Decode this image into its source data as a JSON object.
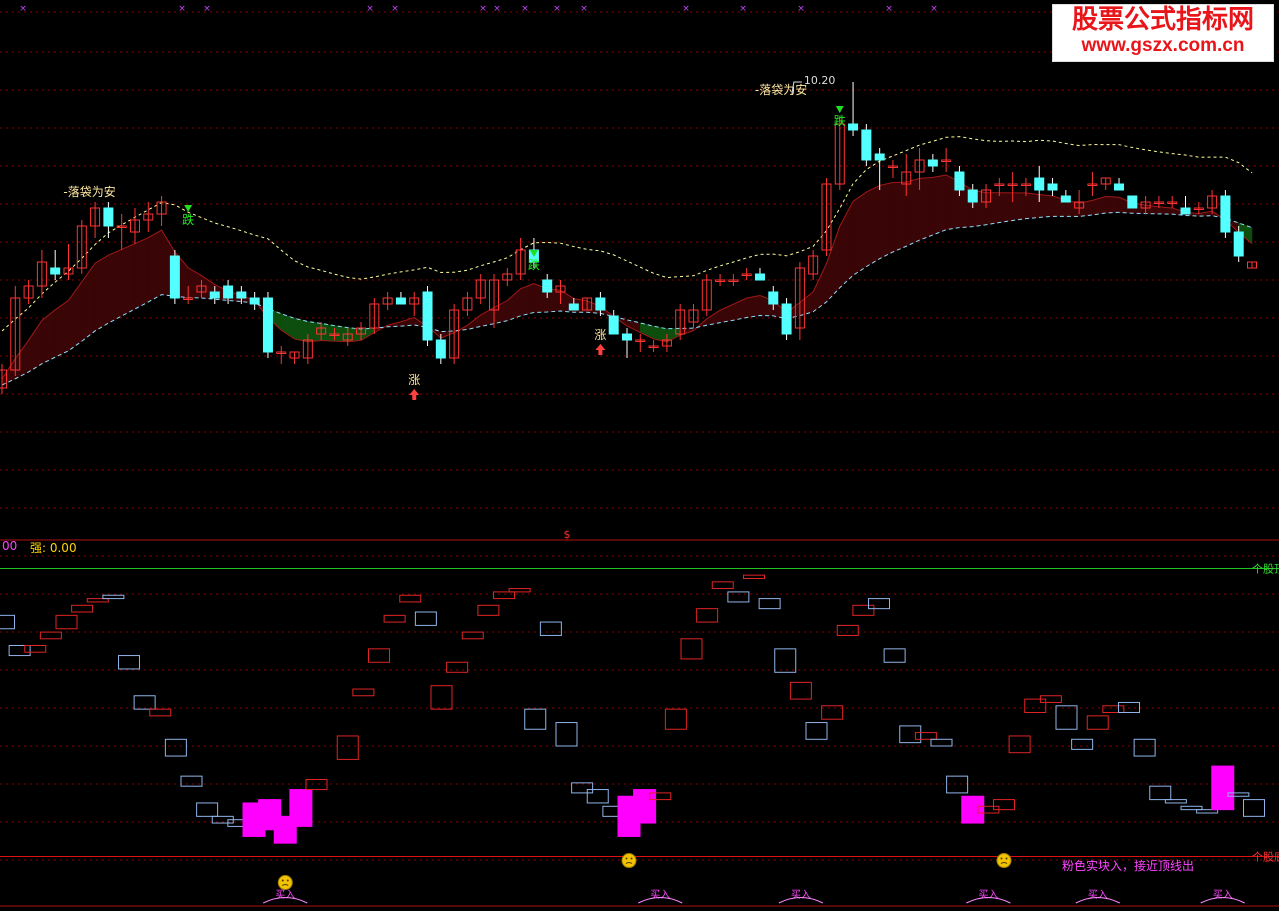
{
  "watermark": {
    "title": "股票公式指标网",
    "url": "www.gszx.com.cn"
  },
  "subpanel_header": {
    "left_value": "00",
    "strength_label": "强: 0.00",
    "dollar_mark": "$"
  },
  "labels": {
    "safe": "-落袋为安",
    "fall": "跌",
    "rise": "涨",
    "price_peak": "10.20",
    "top_line": "个股顶",
    "bottom_line": "个股底",
    "note": "粉色实块入，接近顶线出",
    "buy": "买入"
  },
  "colors": {
    "up": "#ff3333",
    "down": "#54ffff",
    "cloud_red": "#3a0506",
    "cloud_red_edge": "#a01818",
    "cloud_green": "#0d4d0d",
    "dashed_line": "#ffff99",
    "osc_red": "#e02424",
    "osc_blue": "#8fb4e8",
    "osc_pink": "#ff00ff",
    "grid": "#8b0000",
    "top_line": "#22c422",
    "bottom_line": "#dd1111"
  },
  "chart_data": [
    {
      "type": "candlestick",
      "candles": [
        [
          7.5,
          7.9,
          7.4,
          7.8
        ],
        [
          7.8,
          9.2,
          7.7,
          9.0
        ],
        [
          9.0,
          9.3,
          8.9,
          9.2
        ],
        [
          9.2,
          9.8,
          9.0,
          9.6
        ],
        [
          9.5,
          9.8,
          9.3,
          9.4
        ],
        [
          9.4,
          9.9,
          9.3,
          9.5
        ],
        [
          9.5,
          10.3,
          9.4,
          10.2
        ],
        [
          10.2,
          10.6,
          10.0,
          10.5
        ],
        [
          10.5,
          10.6,
          10.0,
          10.2
        ],
        [
          10.2,
          10.4,
          9.8,
          10.2
        ],
        [
          10.1,
          10.5,
          9.9,
          10.3
        ],
        [
          10.3,
          10.6,
          10.1,
          10.4
        ],
        [
          10.4,
          10.7,
          10.2,
          10.6
        ],
        [
          9.7,
          9.8,
          8.9,
          9.0
        ],
        [
          9.0,
          9.2,
          8.9,
          9.0
        ],
        [
          9.1,
          9.3,
          9.0,
          9.2
        ],
        [
          9.1,
          9.2,
          8.9,
          9.0
        ],
        [
          9.2,
          9.3,
          8.9,
          9.0
        ],
        [
          9.1,
          9.2,
          8.9,
          9.0
        ],
        [
          9.0,
          9.1,
          8.8,
          8.9
        ],
        [
          9.0,
          9.1,
          8.0,
          8.1
        ],
        [
          8.1,
          8.2,
          7.9,
          8.1
        ],
        [
          8.0,
          8.1,
          7.9,
          8.1
        ],
        [
          8.0,
          8.4,
          7.9,
          8.3
        ],
        [
          8.4,
          8.6,
          8.3,
          8.5
        ],
        [
          8.4,
          8.5,
          8.3,
          8.4
        ],
        [
          8.3,
          8.5,
          8.2,
          8.4
        ],
        [
          8.4,
          8.6,
          8.3,
          8.5
        ],
        [
          8.5,
          9.0,
          8.4,
          8.9
        ],
        [
          8.9,
          9.1,
          8.8,
          9.0
        ],
        [
          9.0,
          9.1,
          8.9,
          8.9
        ],
        [
          8.9,
          9.1,
          8.7,
          9.0
        ],
        [
          9.1,
          9.2,
          8.2,
          8.3
        ],
        [
          8.3,
          8.4,
          7.9,
          8.0
        ],
        [
          8.0,
          8.9,
          7.9,
          8.8
        ],
        [
          8.8,
          9.1,
          8.7,
          9.0
        ],
        [
          9.0,
          9.4,
          8.9,
          9.3
        ],
        [
          8.8,
          9.4,
          8.5,
          9.3
        ],
        [
          9.3,
          9.5,
          9.2,
          9.4
        ],
        [
          9.4,
          10.0,
          9.3,
          9.8
        ],
        [
          9.8,
          10.0,
          9.5,
          9.6
        ],
        [
          9.3,
          9.4,
          9.0,
          9.1
        ],
        [
          9.1,
          9.3,
          8.9,
          9.2
        ],
        [
          8.9,
          9.0,
          8.8,
          8.8
        ],
        [
          8.8,
          9.0,
          8.8,
          9.0
        ],
        [
          9.0,
          9.1,
          8.7,
          8.8
        ],
        [
          8.7,
          8.8,
          8.4,
          8.4
        ],
        [
          8.4,
          8.5,
          8.0,
          8.3
        ],
        [
          8.3,
          8.4,
          8.1,
          8.3
        ],
        [
          8.2,
          8.3,
          8.1,
          8.2
        ],
        [
          8.2,
          8.4,
          8.1,
          8.3
        ],
        [
          8.4,
          8.9,
          8.3,
          8.8
        ],
        [
          8.6,
          8.9,
          8.5,
          8.8
        ],
        [
          8.8,
          9.4,
          8.7,
          9.3
        ],
        [
          9.3,
          9.4,
          9.2,
          9.3
        ],
        [
          9.3,
          9.4,
          9.2,
          9.3
        ],
        [
          9.4,
          9.5,
          9.3,
          9.4
        ],
        [
          9.4,
          9.5,
          9.3,
          9.3
        ],
        [
          9.1,
          9.2,
          8.8,
          8.9
        ],
        [
          8.9,
          9.0,
          8.3,
          8.4
        ],
        [
          8.5,
          9.6,
          8.3,
          9.5
        ],
        [
          9.4,
          9.8,
          9.3,
          9.7
        ],
        [
          9.8,
          11.0,
          9.7,
          10.9
        ],
        [
          10.9,
          12.0,
          10.8,
          11.9
        ],
        [
          11.9,
          12.6,
          11.7,
          11.8
        ],
        [
          11.8,
          11.9,
          11.2,
          11.3
        ],
        [
          11.4,
          11.5,
          10.8,
          11.3
        ],
        [
          11.2,
          11.3,
          11.0,
          11.2
        ],
        [
          10.9,
          11.4,
          10.7,
          11.1
        ],
        [
          11.1,
          11.5,
          10.8,
          11.3
        ],
        [
          11.3,
          11.4,
          11.1,
          11.2
        ],
        [
          11.3,
          11.5,
          11.1,
          11.3
        ],
        [
          11.1,
          11.2,
          10.7,
          10.8
        ],
        [
          10.8,
          10.9,
          10.5,
          10.6
        ],
        [
          10.6,
          10.9,
          10.5,
          10.8
        ],
        [
          10.9,
          11.0,
          10.7,
          10.9
        ],
        [
          10.9,
          11.1,
          10.6,
          10.9
        ],
        [
          10.9,
          11.0,
          10.7,
          10.9
        ],
        [
          11.0,
          11.2,
          10.6,
          10.8
        ],
        [
          10.9,
          11.0,
          10.7,
          10.8
        ],
        [
          10.7,
          10.8,
          10.6,
          10.6
        ],
        [
          10.5,
          10.8,
          10.4,
          10.6
        ],
        [
          10.9,
          11.1,
          10.7,
          10.9
        ],
        [
          10.9,
          11.0,
          10.8,
          11.0
        ],
        [
          10.9,
          11.0,
          10.8,
          10.8
        ],
        [
          10.7,
          10.7,
          10.5,
          10.5
        ],
        [
          10.5,
          10.7,
          10.4,
          10.6
        ],
        [
          10.6,
          10.7,
          10.5,
          10.6
        ],
        [
          10.6,
          10.7,
          10.5,
          10.6
        ],
        [
          10.5,
          10.7,
          10.4,
          10.4
        ],
        [
          10.5,
          10.6,
          10.4,
          10.5
        ],
        [
          10.5,
          10.8,
          10.4,
          10.7
        ],
        [
          10.7,
          10.8,
          10.0,
          10.1
        ],
        [
          10.1,
          10.2,
          9.6,
          9.7
        ],
        [
          9.5,
          9.6,
          9.5,
          9.6
        ]
      ],
      "markers": [
        {
          "kind": "safe",
          "index": 8,
          "price": 10.7
        },
        {
          "kind": "fall",
          "index": 14,
          "price": 10.35
        },
        {
          "kind": "rise",
          "index": 31,
          "price": 7.5
        },
        {
          "kind": "fall",
          "index": 40,
          "price": 9.6
        },
        {
          "kind": "rise",
          "index": 45,
          "price": 8.25
        },
        {
          "kind": "safe",
          "index": 60,
          "price": 12.4
        },
        {
          "kind": "peak",
          "index": 60,
          "price": 12.6
        },
        {
          "kind": "fall",
          "index": 63,
          "price": 12.0
        }
      ]
    },
    {
      "type": "oscillator",
      "top_level": 93,
      "bottom_level": 7,
      "boxes": [
        [
          0.0,
          75,
          79,
          "b"
        ],
        [
          1.0,
          67,
          70,
          "b"
        ],
        [
          2.0,
          68,
          70,
          "r"
        ],
        [
          3.0,
          72,
          74,
          "r"
        ],
        [
          4.0,
          75,
          79,
          "r"
        ],
        [
          5.0,
          80,
          82,
          "r"
        ],
        [
          6.0,
          83,
          84,
          "r"
        ],
        [
          7.0,
          84,
          85,
          "b"
        ],
        [
          8.0,
          63,
          67,
          "b"
        ],
        [
          9.0,
          51,
          55,
          "b"
        ],
        [
          10.0,
          49,
          51,
          "r"
        ],
        [
          11.0,
          37,
          42,
          "b"
        ],
        [
          12.0,
          28,
          31,
          "b"
        ],
        [
          13.0,
          19,
          23,
          "b"
        ],
        [
          14.0,
          17,
          19,
          "b"
        ],
        [
          15.0,
          16,
          18,
          "b"
        ],
        [
          16.0,
          13,
          23,
          "p"
        ],
        [
          17.0,
          15,
          24,
          "p"
        ],
        [
          18.0,
          11,
          19,
          "p"
        ],
        [
          19.0,
          16,
          27,
          "p"
        ],
        [
          20.0,
          27,
          30,
          "r"
        ],
        [
          22.0,
          36,
          43,
          "r"
        ],
        [
          23.0,
          55,
          57,
          "r"
        ],
        [
          24.0,
          65,
          69,
          "r"
        ],
        [
          25.0,
          77,
          79,
          "r"
        ],
        [
          26.0,
          83,
          85,
          "r"
        ],
        [
          27.0,
          76,
          80,
          "b"
        ],
        [
          28.0,
          51,
          58,
          "r"
        ],
        [
          29.0,
          62,
          65,
          "r"
        ],
        [
          30.0,
          72,
          74,
          "r"
        ],
        [
          31.0,
          79,
          82,
          "r"
        ],
        [
          32.0,
          84,
          86,
          "r"
        ],
        [
          33.0,
          86,
          87,
          "r"
        ],
        [
          34.0,
          45,
          51,
          "b"
        ],
        [
          35.0,
          73,
          77,
          "b"
        ],
        [
          36.0,
          40,
          47,
          "b"
        ],
        [
          37.0,
          26,
          29,
          "b"
        ],
        [
          38.0,
          23,
          27,
          "b"
        ],
        [
          39.0,
          19,
          22,
          "b"
        ],
        [
          40.0,
          13,
          25,
          "p"
        ],
        [
          41.0,
          17,
          27,
          "p"
        ],
        [
          42.0,
          24,
          26,
          "r"
        ],
        [
          43.0,
          45,
          51,
          "r"
        ],
        [
          44.0,
          66,
          72,
          "r"
        ],
        [
          45.0,
          77,
          81,
          "r"
        ],
        [
          46.0,
          87,
          89,
          "r"
        ],
        [
          47.0,
          83,
          86,
          "b"
        ],
        [
          48.0,
          90,
          91,
          "r"
        ],
        [
          49.0,
          81,
          84,
          "b"
        ],
        [
          50.0,
          62,
          69,
          "b"
        ],
        [
          51.0,
          54,
          59,
          "r"
        ],
        [
          52.0,
          42,
          47,
          "b"
        ],
        [
          53.0,
          48,
          52,
          "r"
        ],
        [
          54.0,
          73,
          76,
          "r"
        ],
        [
          55.0,
          79,
          82,
          "r"
        ],
        [
          56.0,
          81,
          84,
          "b"
        ],
        [
          57.0,
          65,
          69,
          "b"
        ],
        [
          58.0,
          41,
          46,
          "b"
        ],
        [
          59.0,
          42,
          44,
          "r"
        ],
        [
          60.0,
          40,
          42,
          "b"
        ],
        [
          61.0,
          26,
          31,
          "b"
        ],
        [
          62.0,
          17,
          25,
          "p"
        ],
        [
          63.0,
          20,
          22,
          "r"
        ],
        [
          64.0,
          21,
          24,
          "r"
        ],
        [
          65.0,
          38,
          43,
          "r"
        ],
        [
          66.0,
          50,
          54,
          "r"
        ],
        [
          67.0,
          53,
          55,
          "r"
        ],
        [
          68.0,
          45,
          52,
          "b"
        ],
        [
          69.0,
          39,
          42,
          "b"
        ],
        [
          70.0,
          45,
          49,
          "r"
        ],
        [
          71.0,
          50,
          52,
          "r"
        ],
        [
          72.0,
          50,
          53,
          "b"
        ],
        [
          73.0,
          37,
          42,
          "b"
        ],
        [
          74.0,
          24,
          28,
          "b"
        ],
        [
          75.0,
          23,
          24,
          "b"
        ],
        [
          76.0,
          21,
          22,
          "b"
        ],
        [
          77.0,
          20,
          21,
          "b"
        ],
        [
          78.0,
          21,
          34,
          "p"
        ],
        [
          79.0,
          25,
          26,
          "b"
        ],
        [
          80.0,
          19,
          24,
          "b"
        ]
      ],
      "faces": [
        18,
        40,
        64
      ],
      "buy_signals": [
        18,
        42,
        51,
        63,
        70,
        78
      ]
    }
  ]
}
